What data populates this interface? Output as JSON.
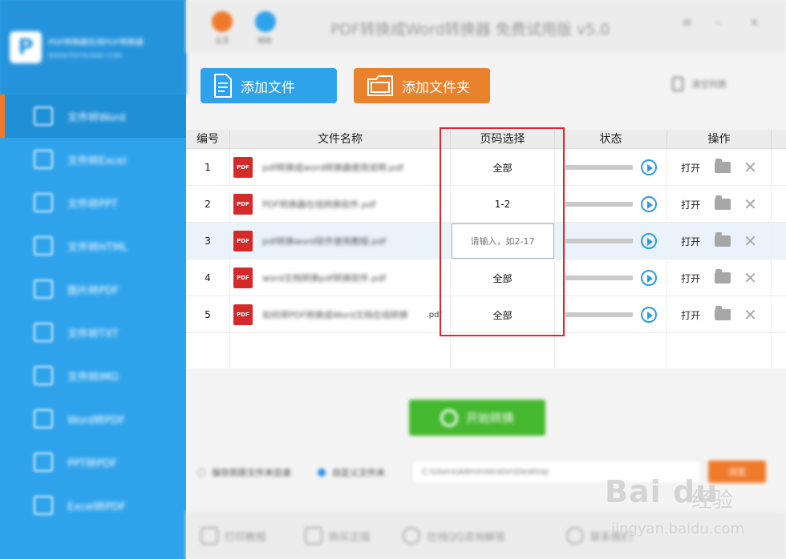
{
  "sidebar": {
    "brand_title": "PDF转换器在线PDF转换器",
    "brand_sub": "WWW.PDFHUANG.COM",
    "items": [
      {
        "label": "文件转Word",
        "icon": "word-icon",
        "active": true
      },
      {
        "label": "文件转Excel",
        "icon": "excel-icon",
        "active": false
      },
      {
        "label": "文件转PPT",
        "icon": "ppt-icon",
        "active": false
      },
      {
        "label": "文件转HTML",
        "icon": "html-icon",
        "active": false
      },
      {
        "label": "图片转PDF",
        "icon": "image-icon",
        "active": false
      },
      {
        "label": "文件转TXT",
        "icon": "txt-icon",
        "active": false
      },
      {
        "label": "文件转IMG",
        "icon": "img-icon",
        "active": false
      },
      {
        "label": "Word转PDF",
        "icon": "word-pdf-icon",
        "active": false
      },
      {
        "label": "PPT转PDF",
        "icon": "ppt-pdf-icon",
        "active": false
      },
      {
        "label": "Excel转PDF",
        "icon": "excel-pdf-icon",
        "active": false
      }
    ]
  },
  "titlebar": {
    "title": "PDF转换成Word转换器 免费试用版 v5.0",
    "btn_home": "主页",
    "btn_help": "帮助",
    "minimize": "–",
    "close": "×",
    "menu": "≡"
  },
  "toolbar": {
    "add_file": "添加文件",
    "add_folder": "添加文件夹",
    "clear_list": "清空列表"
  },
  "table": {
    "headers": [
      "编号",
      "文件名称",
      "页码选择",
      "状态",
      "操作"
    ],
    "rows": [
      {
        "num": "1",
        "name": "pdf转换成word转换器使用说明.pdf",
        "suffix": "",
        "pages": "全部",
        "open": "打开",
        "highlight": false
      },
      {
        "num": "2",
        "name": "PDF转换器在线转换软件.pdf",
        "suffix": "",
        "pages": "1-2",
        "open": "打开",
        "highlight": false
      },
      {
        "num": "3",
        "name": "pdf转换word软件使用教程.pdf",
        "suffix": "",
        "pages": "",
        "open": "打开",
        "highlight": true
      },
      {
        "num": "4",
        "name": "word文档转换pdf转换软件.pdf",
        "suffix": "",
        "pages": "全部",
        "open": "打开",
        "highlight": false
      },
      {
        "num": "5",
        "name": "如何将PDF转换成Word文档在线转换",
        "suffix": ".pdf",
        "pages": "全部",
        "open": "打开",
        "highlight": false
      }
    ],
    "page_input_placeholder": "请输入，如2-17"
  },
  "actions": {
    "start": "开始转换",
    "option_original": "保存到原文件夹目录",
    "option_custom": "自定义文件夹",
    "path": "C:\\Users\\Administrator\\Desktop",
    "browse": "浏览"
  },
  "bottom": {
    "items": [
      "打印教程",
      "购买正版",
      "在线QQ咨询解答",
      "联系我们"
    ]
  },
  "watermark": {
    "brand": "Bai du",
    "cn": "经验",
    "url": "jingyan.baidu.com"
  },
  "colors": {
    "sidebar": "#2ea3ec",
    "active_indicator": "#f07a2c",
    "add_file": "#2ea3ec",
    "add_folder": "#e9822d",
    "start": "#44b82e",
    "pdf_icon": "#d42a2a",
    "highlight_box": "#e2252c"
  }
}
